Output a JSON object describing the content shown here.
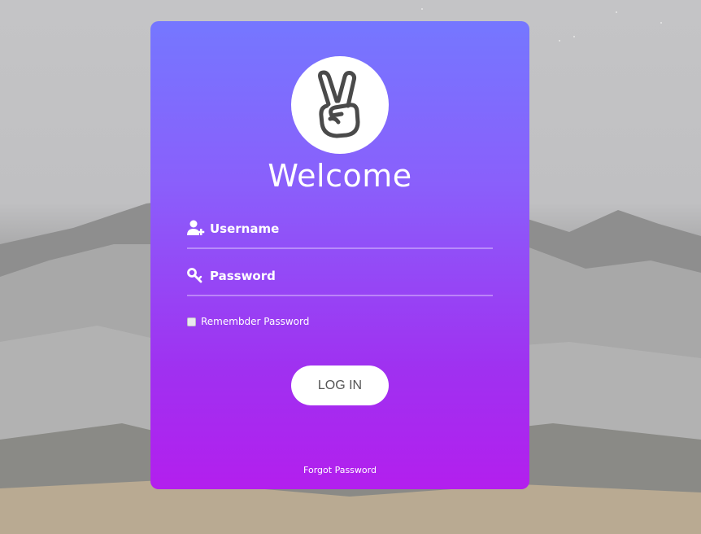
{
  "background": {
    "description_icon": "snowy-mountain-night"
  },
  "colors": {
    "card_gradient_top": "#7577ff",
    "card_gradient_bottom": "#b31fee",
    "button_bg": "#ffffff",
    "button_text": "#555555",
    "text": "#ffffff"
  },
  "card": {
    "logo_icon": "peace-hand-icon",
    "title": "Welcome",
    "username": {
      "icon": "user-plus-icon",
      "placeholder": "Username",
      "value": ""
    },
    "password": {
      "icon": "key-icon",
      "placeholder": "Password",
      "value": ""
    },
    "remember": {
      "label": "Remembder Password",
      "checked": false
    },
    "login_label": "LOG IN",
    "forgot_label": "Forgot Password"
  }
}
